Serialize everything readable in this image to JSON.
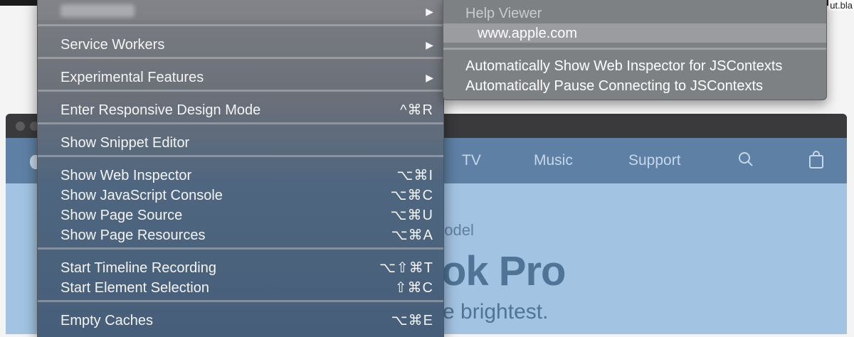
{
  "top_right_text": "ut.bla",
  "background_page": {
    "nav": [
      "TV",
      "Music",
      "Support"
    ],
    "hero_subtitle": "nodel",
    "hero_title": "ok Pro",
    "hero_tagline": "e brightest."
  },
  "develop_menu": {
    "top_item_label": "",
    "items": [
      {
        "label": "Service Workers",
        "shortcut": "",
        "submenu": true
      },
      {
        "label": "Experimental Features",
        "shortcut": "",
        "submenu": true
      },
      {
        "label": "Enter Responsive Design Mode",
        "shortcut": "^⌘R"
      },
      {
        "label": "Show Snippet Editor",
        "shortcut": ""
      },
      {
        "label": "Show Web Inspector",
        "shortcut": "⌥⌘I"
      },
      {
        "label": "Show JavaScript Console",
        "shortcut": "⌥⌘C"
      },
      {
        "label": "Show Page Source",
        "shortcut": "⌥⌘U"
      },
      {
        "label": "Show Page Resources",
        "shortcut": "⌥⌘A"
      },
      {
        "label": "Start Timeline Recording",
        "shortcut": "⌥⇧⌘T"
      },
      {
        "label": "Start Element Selection",
        "shortcut": "⇧⌘C"
      },
      {
        "label": "Empty Caches",
        "shortcut": "⌥⌘E"
      }
    ],
    "arrow": "▶"
  },
  "submenu": {
    "header": "Help Viewer",
    "highlighted": "www.apple.com",
    "items": [
      "Automatically Show Web Inspector for JSContexts",
      "Automatically Pause Connecting to JSContexts"
    ]
  },
  "colors": {
    "menu_text": "#f4f4f4",
    "submenu_header": "#c9cbce",
    "page_blue": "#a2c3e2"
  }
}
